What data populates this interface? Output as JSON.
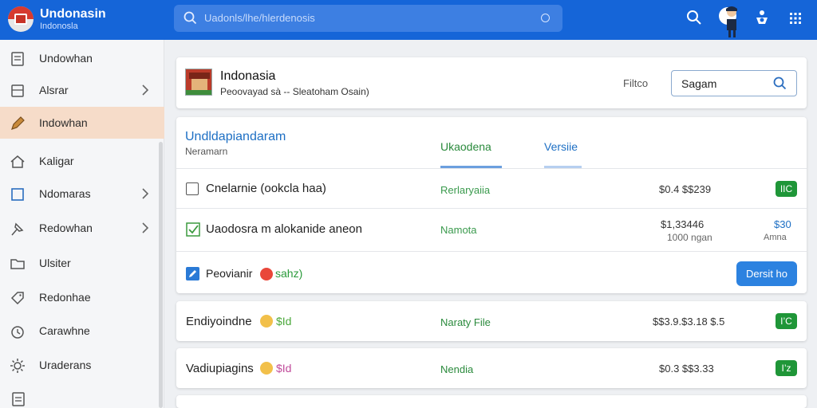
{
  "header": {
    "app_title": "Undonasin",
    "app_subtitle": "Indonosla",
    "search_placeholder": "Uadonls/lhe/hlerdenosis"
  },
  "sidebar": {
    "items": [
      {
        "label": "Undowhan",
        "icon": "document-icon",
        "active": false,
        "chevron": false
      },
      {
        "label": "Alsrar",
        "icon": "list-icon",
        "active": false,
        "chevron": true
      },
      {
        "label": "Indowhan",
        "icon": "pen-icon",
        "active": true,
        "chevron": false
      },
      {
        "label": "Kaligar",
        "icon": "home-icon",
        "active": false,
        "chevron": false
      },
      {
        "label": "Ndomaras",
        "icon": "square-icon",
        "active": false,
        "chevron": true
      },
      {
        "label": "Redowhan",
        "icon": "pin-icon",
        "active": false,
        "chevron": true
      },
      {
        "label": "Ulsiter",
        "icon": "folder-icon",
        "active": false,
        "chevron": false
      },
      {
        "label": "Redonhae",
        "icon": "tag-icon",
        "active": false,
        "chevron": false
      },
      {
        "label": "Carawhne",
        "icon": "clock-icon",
        "active": false,
        "chevron": false
      },
      {
        "label": "Uraderans",
        "icon": "gear-icon",
        "active": false,
        "chevron": false
      }
    ]
  },
  "page_header": {
    "title": "Indonasia",
    "subtitle": "Peoovayad sà -- Sleatoham Osain)",
    "filter_label": "Filtco",
    "filter_value": "Sagam"
  },
  "section": {
    "title": "Undldapiandaram",
    "subtitle": "Neramarn",
    "tabs": [
      {
        "label": "Ukaodena",
        "active": true
      },
      {
        "label": "Versiie",
        "active": false
      }
    ]
  },
  "rows": [
    {
      "text": "Cnelarnie (ookcla haa)",
      "mid": "Rerlaryaiia",
      "amount": "$0.4 $$239",
      "badge": "IIC"
    },
    {
      "text": "Uaodosra m alokanide aneon",
      "mid": "Namota",
      "amount": "$1,33446",
      "amount2": "1000 ngan",
      "value": "$30",
      "value_sub": "Amna"
    },
    {
      "text": "Peovianir",
      "tag": "sahz)",
      "button": "Dersit ho"
    }
  ],
  "list_rows": [
    {
      "text": "Endiyoindne",
      "tag": "$Id",
      "mid": "Naraty File",
      "amount": "$$3.9.$3.18 $.5",
      "badge": "I’C"
    },
    {
      "text": "Vadiupiagins",
      "tag": "$Id",
      "mid": "Nendia",
      "amount": "$0.3 $$3.33",
      "badge": "I’z"
    }
  ],
  "colors": {
    "topbar": "#1565d8",
    "accent_green": "#1f9638",
    "accent_blue": "#1d6fc4",
    "active_sidebar": "#f6dcc9"
  }
}
